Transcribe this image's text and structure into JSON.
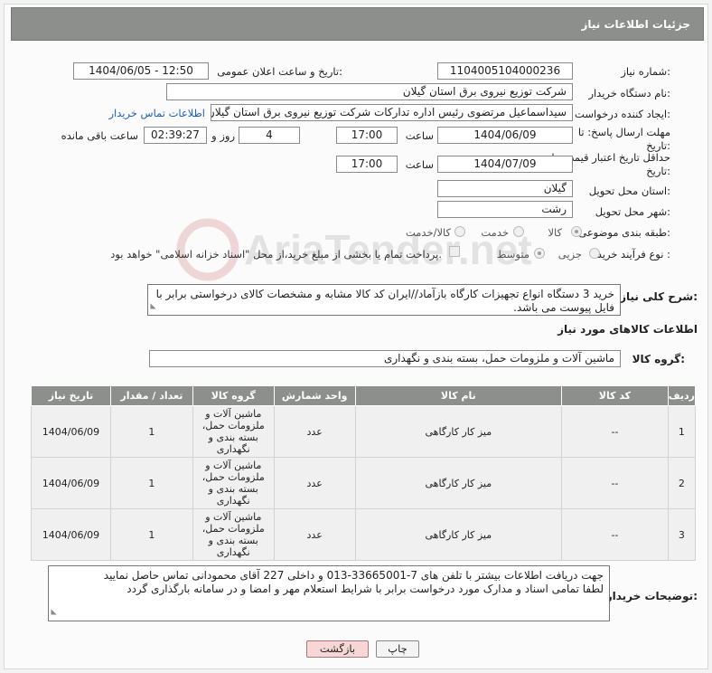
{
  "header": {
    "title": "جزئیات اطلاعات نیاز"
  },
  "form": {
    "need_number": {
      "label": "شماره نیاز:",
      "value": "1104005104000236"
    },
    "announce": {
      "label": "تاریخ و ساعت اعلان عمومی:",
      "value": "1404/06/05 - 12:50"
    },
    "buyer_org": {
      "label": "نام دستگاه خریدار:",
      "value": "شرکت توزیع نیروی برق استان گیلان"
    },
    "requester": {
      "label": "ایجاد کننده درخواست:",
      "value": "سیداسماعیل مرتضوی رئیس اداره تدارکات شرکت توزیع نیروی برق استان گیلان",
      "contact_link": "اطلاعات تماس خریدار"
    },
    "deadline": {
      "label": "مهلت ارسال پاسخ: تا تاریخ:",
      "date": "1404/06/09",
      "time_label": "ساعت",
      "time": "17:00",
      "days": "4",
      "days_label": "روز و",
      "remaining": "02:39:27",
      "remaining_label": "ساعت باقی مانده"
    },
    "price_validity": {
      "label": "حداقل تاریخ اعتبار قیمت: تا تاریخ:",
      "date": "1404/07/09",
      "time_label": "ساعت",
      "time": "17:00"
    },
    "province": {
      "label": "استان محل تحویل:",
      "value": "گیلان"
    },
    "city": {
      "label": "شهر محل تحویل:",
      "value": "رشت"
    },
    "category": {
      "label": "طبقه بندی موضوعی:",
      "options": [
        "کالا",
        "خدمت",
        "کالا/خدمت"
      ]
    },
    "process": {
      "label": "نوع فرآیند خرید :",
      "options": [
        "جزیی",
        "متوسط"
      ],
      "note": "پرداخت تمام یا بخشی از مبلغ خرید،از محل \"اسناد خزانه اسلامی\" خواهد بود."
    },
    "description": {
      "label": "شرح کلی نیاز:",
      "value": "خرید 3 دستگاه انواع تجهیزات کارگاه بازآماد//ایران کد کالا مشابه و مشخصات کالای درخواستی برابر با فایل پیوست می باشد."
    }
  },
  "goods_section": {
    "title": "اطلاعات کالاهای مورد نیاز",
    "group_label": "گروه کالا:",
    "group_value": "ماشین آلات و ملزومات حمل، بسته بندی و نگهداری"
  },
  "table": {
    "headers": [
      "ردیف",
      "کد کالا",
      "نام کالا",
      "واحد شمارش",
      "گروه کالا",
      "تعداد / مقدار",
      "تاریخ نیاز"
    ],
    "rows": [
      {
        "idx": "1",
        "code": "--",
        "name": "میز کار کارگاهی",
        "unit": "عدد",
        "group": "ماشین آلات و ملزومات حمل، بسته بندی و نگهداری",
        "qty": "1",
        "date": "1404/06/09"
      },
      {
        "idx": "2",
        "code": "--",
        "name": "میز کار کارگاهی",
        "unit": "عدد",
        "group": "ماشین آلات و ملزومات حمل، بسته بندی و نگهداری",
        "qty": "1",
        "date": "1404/06/09"
      },
      {
        "idx": "3",
        "code": "--",
        "name": "میز کار کارگاهی",
        "unit": "عدد",
        "group": "ماشین آلات و ملزومات حمل، بسته بندی و نگهداری",
        "qty": "1",
        "date": "1404/06/09"
      }
    ]
  },
  "buyer_notes": {
    "label": "توضیحات خریدار:",
    "line1": "جهت دریافت اطلاعات بیشتر با تلفن های 7-33665001-013 و داخلی 227 آقای محمودانی تماس حاصل نمایید",
    "line2": "لطفا تمامی اسناد و مدارک مورد درخواست برابر با شرایط استعلام مهر و امضا و در سامانه بارگذاری گردد"
  },
  "buttons": {
    "print": "چاپ",
    "back": "بازگشت"
  },
  "watermark": {
    "text": "AriaTender.net"
  },
  "colors": {
    "header_bg": "#8d8f8d",
    "link": "#1f5fbf",
    "back_button": "#f7d6d6"
  }
}
